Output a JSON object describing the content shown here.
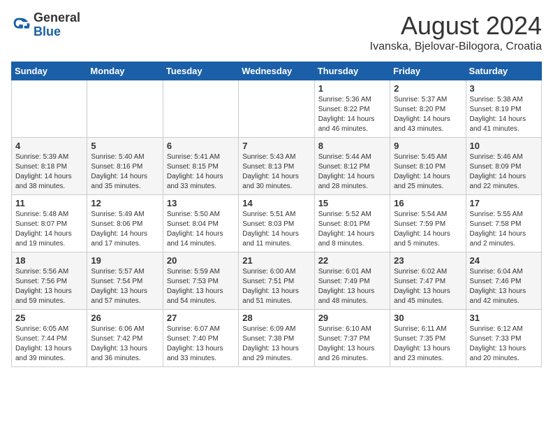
{
  "header": {
    "logo_general": "General",
    "logo_blue": "Blue",
    "month_year": "August 2024",
    "location": "Ivanska, Bjelovar-Bilogora, Croatia"
  },
  "days_of_week": [
    "Sunday",
    "Monday",
    "Tuesday",
    "Wednesday",
    "Thursday",
    "Friday",
    "Saturday"
  ],
  "weeks": [
    {
      "cells": [
        {
          "day": "",
          "info": ""
        },
        {
          "day": "",
          "info": ""
        },
        {
          "day": "",
          "info": ""
        },
        {
          "day": "",
          "info": ""
        },
        {
          "day": "1",
          "info": "Sunrise: 5:36 AM\nSunset: 8:22 PM\nDaylight: 14 hours\nand 46 minutes."
        },
        {
          "day": "2",
          "info": "Sunrise: 5:37 AM\nSunset: 8:20 PM\nDaylight: 14 hours\nand 43 minutes."
        },
        {
          "day": "3",
          "info": "Sunrise: 5:38 AM\nSunset: 8:19 PM\nDaylight: 14 hours\nand 41 minutes."
        }
      ]
    },
    {
      "cells": [
        {
          "day": "4",
          "info": "Sunrise: 5:39 AM\nSunset: 8:18 PM\nDaylight: 14 hours\nand 38 minutes."
        },
        {
          "day": "5",
          "info": "Sunrise: 5:40 AM\nSunset: 8:16 PM\nDaylight: 14 hours\nand 35 minutes."
        },
        {
          "day": "6",
          "info": "Sunrise: 5:41 AM\nSunset: 8:15 PM\nDaylight: 14 hours\nand 33 minutes."
        },
        {
          "day": "7",
          "info": "Sunrise: 5:43 AM\nSunset: 8:13 PM\nDaylight: 14 hours\nand 30 minutes."
        },
        {
          "day": "8",
          "info": "Sunrise: 5:44 AM\nSunset: 8:12 PM\nDaylight: 14 hours\nand 28 minutes."
        },
        {
          "day": "9",
          "info": "Sunrise: 5:45 AM\nSunset: 8:10 PM\nDaylight: 14 hours\nand 25 minutes."
        },
        {
          "day": "10",
          "info": "Sunrise: 5:46 AM\nSunset: 8:09 PM\nDaylight: 14 hours\nand 22 minutes."
        }
      ]
    },
    {
      "cells": [
        {
          "day": "11",
          "info": "Sunrise: 5:48 AM\nSunset: 8:07 PM\nDaylight: 14 hours\nand 19 minutes."
        },
        {
          "day": "12",
          "info": "Sunrise: 5:49 AM\nSunset: 8:06 PM\nDaylight: 14 hours\nand 17 minutes."
        },
        {
          "day": "13",
          "info": "Sunrise: 5:50 AM\nSunset: 8:04 PM\nDaylight: 14 hours\nand 14 minutes."
        },
        {
          "day": "14",
          "info": "Sunrise: 5:51 AM\nSunset: 8:03 PM\nDaylight: 14 hours\nand 11 minutes."
        },
        {
          "day": "15",
          "info": "Sunrise: 5:52 AM\nSunset: 8:01 PM\nDaylight: 14 hours\nand 8 minutes."
        },
        {
          "day": "16",
          "info": "Sunrise: 5:54 AM\nSunset: 7:59 PM\nDaylight: 14 hours\nand 5 minutes."
        },
        {
          "day": "17",
          "info": "Sunrise: 5:55 AM\nSunset: 7:58 PM\nDaylight: 14 hours\nand 2 minutes."
        }
      ]
    },
    {
      "cells": [
        {
          "day": "18",
          "info": "Sunrise: 5:56 AM\nSunset: 7:56 PM\nDaylight: 13 hours\nand 59 minutes."
        },
        {
          "day": "19",
          "info": "Sunrise: 5:57 AM\nSunset: 7:54 PM\nDaylight: 13 hours\nand 57 minutes."
        },
        {
          "day": "20",
          "info": "Sunrise: 5:59 AM\nSunset: 7:53 PM\nDaylight: 13 hours\nand 54 minutes."
        },
        {
          "day": "21",
          "info": "Sunrise: 6:00 AM\nSunset: 7:51 PM\nDaylight: 13 hours\nand 51 minutes."
        },
        {
          "day": "22",
          "info": "Sunrise: 6:01 AM\nSunset: 7:49 PM\nDaylight: 13 hours\nand 48 minutes."
        },
        {
          "day": "23",
          "info": "Sunrise: 6:02 AM\nSunset: 7:47 PM\nDaylight: 13 hours\nand 45 minutes."
        },
        {
          "day": "24",
          "info": "Sunrise: 6:04 AM\nSunset: 7:46 PM\nDaylight: 13 hours\nand 42 minutes."
        }
      ]
    },
    {
      "cells": [
        {
          "day": "25",
          "info": "Sunrise: 6:05 AM\nSunset: 7:44 PM\nDaylight: 13 hours\nand 39 minutes."
        },
        {
          "day": "26",
          "info": "Sunrise: 6:06 AM\nSunset: 7:42 PM\nDaylight: 13 hours\nand 36 minutes."
        },
        {
          "day": "27",
          "info": "Sunrise: 6:07 AM\nSunset: 7:40 PM\nDaylight: 13 hours\nand 33 minutes."
        },
        {
          "day": "28",
          "info": "Sunrise: 6:09 AM\nSunset: 7:38 PM\nDaylight: 13 hours\nand 29 minutes."
        },
        {
          "day": "29",
          "info": "Sunrise: 6:10 AM\nSunset: 7:37 PM\nDaylight: 13 hours\nand 26 minutes."
        },
        {
          "day": "30",
          "info": "Sunrise: 6:11 AM\nSunset: 7:35 PM\nDaylight: 13 hours\nand 23 minutes."
        },
        {
          "day": "31",
          "info": "Sunrise: 6:12 AM\nSunset: 7:33 PM\nDaylight: 13 hours\nand 20 minutes."
        }
      ]
    }
  ]
}
